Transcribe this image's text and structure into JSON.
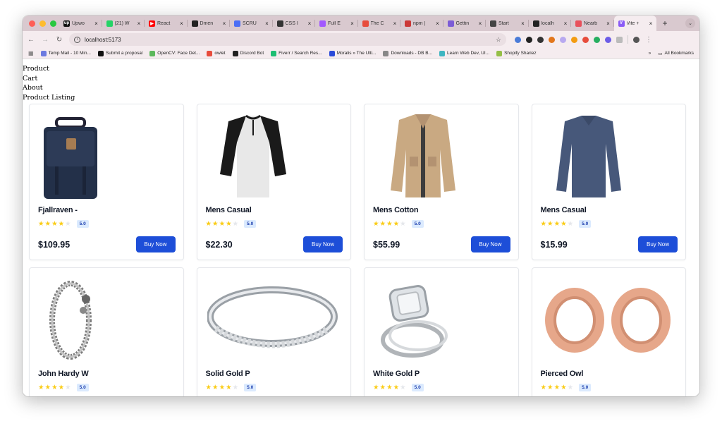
{
  "browser": {
    "tabs": [
      {
        "title": "Upwo",
        "color": "#111111",
        "glyph": "up"
      },
      {
        "title": "(21) W",
        "color": "#25d366",
        "glyph": ""
      },
      {
        "title": "React",
        "color": "#ff0000",
        "glyph": "▶"
      },
      {
        "title": "Dmen",
        "color": "#222222",
        "glyph": ""
      },
      {
        "title": "SCRU",
        "color": "#4c6ef5",
        "glyph": ""
      },
      {
        "title": "CSS I",
        "color": "#333333",
        "glyph": ""
      },
      {
        "title": "Full E",
        "color": "#a259ff",
        "glyph": ""
      },
      {
        "title": "The C",
        "color": "#e74c3c",
        "glyph": ""
      },
      {
        "title": "npm |",
        "color": "#cb3837",
        "glyph": ""
      },
      {
        "title": "Gettin",
        "color": "#7c5cd6",
        "glyph": ""
      },
      {
        "title": "Start",
        "color": "#444444",
        "glyph": ""
      },
      {
        "title": "localh",
        "color": "#222222",
        "glyph": ""
      },
      {
        "title": "Nearb",
        "color": "#e8505b",
        "glyph": ""
      },
      {
        "title": "Vite +",
        "color": "#8b5cf6",
        "glyph": "V",
        "active": true
      }
    ],
    "url": "localhost:5173",
    "bookmarks": [
      {
        "label": "Temp Mail - 10 Min...",
        "color": "#6c7ae0"
      },
      {
        "label": "Submit a proposal",
        "color": "#111111"
      },
      {
        "label": "OpenCV: Face Det...",
        "color": "#5cb85c"
      },
      {
        "label": "owlet",
        "color": "#e74c3c"
      },
      {
        "label": "Discord Bot",
        "color": "#222222"
      },
      {
        "label": "Fiverr / Search Res...",
        "color": "#1dbf73"
      },
      {
        "label": "Moralis » The Ulti...",
        "color": "#2b4bd9"
      },
      {
        "label": "Downloads - DB B...",
        "color": "#888888"
      },
      {
        "label": "Learn Web Dev, UI...",
        "color": "#3fb6c2"
      },
      {
        "label": "Shopify Shariez",
        "color": "#95bf47"
      }
    ],
    "bookmarks_overflow": "»",
    "all_bookmarks": "All Bookmarks"
  },
  "nav": [
    "Product",
    "Cart",
    "About",
    "Product Listing"
  ],
  "products": [
    {
      "title": "Fjallraven -",
      "price": "$109.95",
      "rating": "5.0",
      "stars": 4,
      "image": "backpack"
    },
    {
      "title": "Mens Casual",
      "price": "$22.30",
      "rating": "5.0",
      "stars": 4,
      "image": "henley-shirt"
    },
    {
      "title": "Mens Cotton",
      "price": "$55.99",
      "rating": "5.0",
      "stars": 4,
      "image": "cotton-jacket"
    },
    {
      "title": "Mens Casual",
      "price": "$15.99",
      "rating": "5.0",
      "stars": 4,
      "image": "navy-longsleeve"
    },
    {
      "title": "John Hardy W",
      "price": "",
      "rating": "5.0",
      "stars": 4,
      "image": "chain-bracelet"
    },
    {
      "title": "Solid Gold P",
      "price": "",
      "rating": "5.0",
      "stars": 4,
      "image": "diamond-band"
    },
    {
      "title": "White Gold P",
      "price": "",
      "rating": "5.0",
      "stars": 4,
      "image": "engagement-ring"
    },
    {
      "title": "Pierced Owl",
      "price": "",
      "rating": "5.0",
      "stars": 4,
      "image": "rose-gold-plugs"
    }
  ],
  "buy_label": "Buy Now",
  "colors": {
    "accent": "#1d4ed8",
    "star": "#facc15",
    "badge_bg": "#dbeafe",
    "tab_strip": "#d9c9cf"
  }
}
